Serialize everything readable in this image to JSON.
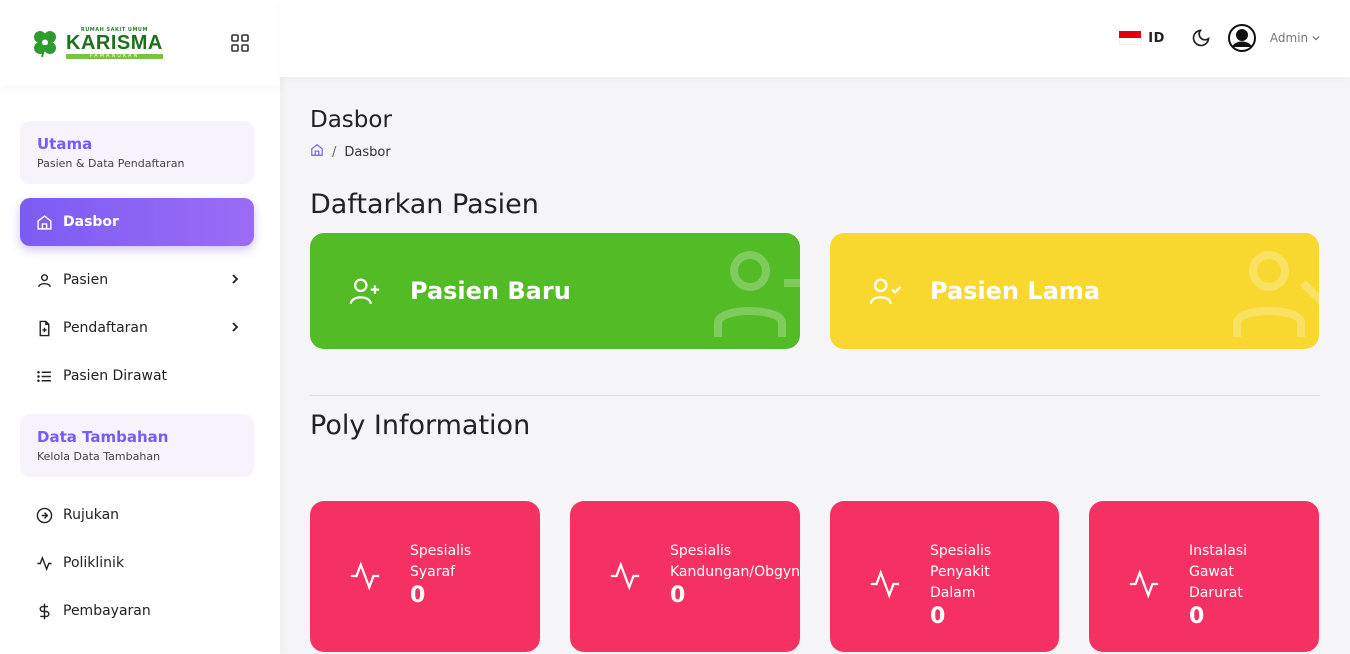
{
  "logo": {
    "small_text": "RUMAH SAKIT UMUM",
    "name": "KARISMA",
    "sub_text": "PAMANUKAN"
  },
  "sidebar": {
    "sections": [
      {
        "title": "Utama",
        "subtitle": "Pasien & Data Pendaftaran"
      },
      {
        "title": "Data Tambahan",
        "subtitle": "Kelola Data Tambahan"
      }
    ],
    "items": [
      {
        "label": "Dasbor",
        "icon": "home-icon",
        "active": true
      },
      {
        "label": "Pasien",
        "icon": "user-icon",
        "has_submenu": true
      },
      {
        "label": "Pendaftaran",
        "icon": "file-plus-icon",
        "has_submenu": true
      },
      {
        "label": "Pasien Dirawat",
        "icon": "list-icon"
      },
      {
        "label": "Rujukan",
        "icon": "arrow-circle-icon"
      },
      {
        "label": "Poliklinik",
        "icon": "activity-icon"
      },
      {
        "label": "Pembayaran",
        "icon": "dollar-icon"
      }
    ]
  },
  "header": {
    "language": "ID",
    "user": "Admin"
  },
  "main": {
    "page_title": "Dasbor",
    "breadcrumb": [
      "Dasbor"
    ],
    "register_title": "Daftarkan Pasien",
    "register_cards": [
      {
        "label": "Pasien Baru",
        "color": "#52bb26",
        "icon": "user-plus-icon"
      },
      {
        "label": "Pasien Lama",
        "color": "#f8d72f",
        "icon": "user-check-icon"
      }
    ],
    "poly_title": "Poly Information",
    "poly_cards": [
      {
        "line1": "Spesialis",
        "line2": "Syaraf",
        "line3": "",
        "value": "0"
      },
      {
        "line1": "Spesialis",
        "line2": "Kandungan/Obgyn",
        "line3": "",
        "value": "0"
      },
      {
        "line1": "Spesialis",
        "line2": "Penyakit",
        "line3": "Dalam",
        "value": "0"
      },
      {
        "line1": "Instalasi",
        "line2": "Gawat",
        "line3": "Darurat",
        "value": "0"
      }
    ],
    "poly_color": "#f53163",
    "accent": "#7b5cf3"
  }
}
